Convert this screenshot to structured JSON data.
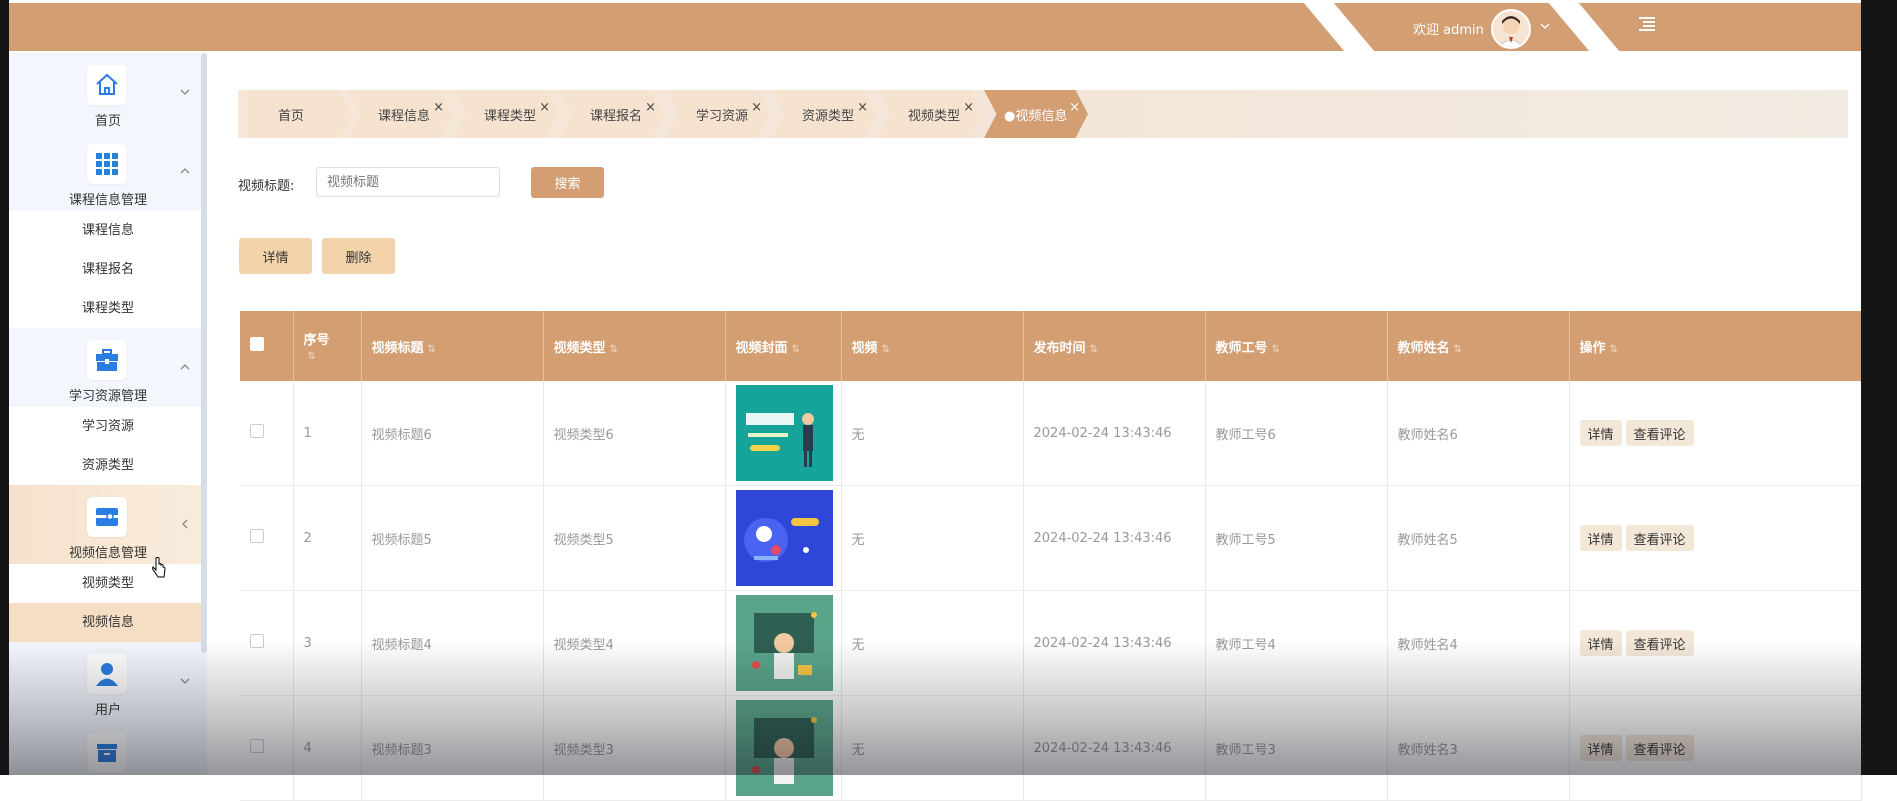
{
  "header": {
    "welcome_text": "欢迎 admin",
    "avatar_icon": "user-avatar-icon",
    "chevron_icon": "chevron-down-icon",
    "menu_icon": "menu-toggle-icon",
    "background_color": "#d39e72"
  },
  "sidebar": {
    "menus": [
      {
        "label": "首页",
        "icon": "home-icon",
        "expanded": false,
        "items": []
      },
      {
        "label": "课程信息管理",
        "icon": "grid-icon",
        "expanded": true,
        "items": [
          "课程信息",
          "课程报名",
          "课程类型"
        ]
      },
      {
        "label": "学习资源管理",
        "icon": "briefcase-icon",
        "expanded": true,
        "items": [
          "学习资源",
          "资源类型"
        ]
      },
      {
        "label": "视频信息管理",
        "icon": "video-card-icon",
        "expanded": true,
        "items": [
          "视频类型",
          "视频信息"
        ],
        "active_item": "视频信息"
      },
      {
        "label": "用户",
        "icon": "user-icon",
        "expanded": false,
        "items": []
      }
    ]
  },
  "tabs": [
    {
      "label": "首页",
      "closable": false,
      "active": false
    },
    {
      "label": "课程信息",
      "closable": true,
      "active": false
    },
    {
      "label": "课程类型",
      "closable": true,
      "active": false
    },
    {
      "label": "课程报名",
      "closable": true,
      "active": false
    },
    {
      "label": "学习资源",
      "closable": true,
      "active": false
    },
    {
      "label": "资源类型",
      "closable": true,
      "active": false
    },
    {
      "label": "视频类型",
      "closable": true,
      "active": false
    },
    {
      "label": "●视频信息",
      "closable": true,
      "active": true
    }
  ],
  "tab_close_glyph": "×",
  "search": {
    "label": "视频标题:",
    "placeholder": "视频标题",
    "button": "搜索"
  },
  "actions": {
    "detail": "详情",
    "delete": "删除"
  },
  "table": {
    "columns": [
      "序号",
      "视频标题",
      "视频类型",
      "视频封面",
      "视频",
      "发布时间",
      "教师工号",
      "教师姓名",
      "操作"
    ],
    "sort_glyph": "⇅",
    "rows": [
      {
        "index": "1",
        "title": "视频标题6",
        "type": "视频类型6",
        "cover": "cover-teal",
        "video": "无",
        "time": "2024-02-24 13:43:46",
        "teacher_no": "教师工号6",
        "teacher_name": "教师姓名6"
      },
      {
        "index": "2",
        "title": "视频标题5",
        "type": "视频类型5",
        "cover": "cover-blue",
        "video": "无",
        "time": "2024-02-24 13:43:46",
        "teacher_no": "教师工号5",
        "teacher_name": "教师姓名5"
      },
      {
        "index": "3",
        "title": "视频标题4",
        "type": "视频类型4",
        "cover": "cover-green",
        "video": "无",
        "time": "2024-02-24 13:43:46",
        "teacher_no": "教师工号4",
        "teacher_name": "教师姓名4"
      },
      {
        "index": "4",
        "title": "视频标题3",
        "type": "视频类型3",
        "cover": "cover-green",
        "video": "无",
        "time": "2024-02-24 13:43:46",
        "teacher_no": "教师工号3",
        "teacher_name": "教师姓名3"
      }
    ],
    "row_buttons": {
      "detail": "详情",
      "comments": "查看评论"
    }
  },
  "colors": {
    "accent": "#d39e72",
    "light_button": "#f3d4aa",
    "sidebar_bg": "#f3f6fc",
    "icon_blue": "#2a7de1"
  }
}
